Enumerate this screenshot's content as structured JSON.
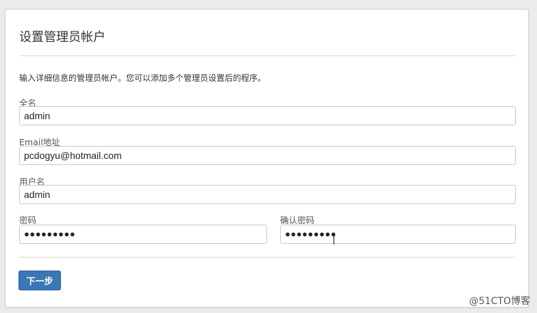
{
  "form": {
    "title": "设置管理员帐户",
    "description": "输入详细信息的管理员帐户。您可以添加多个管理员设置后的程序。",
    "fullname_label": "全名",
    "fullname_value": "admin",
    "email_label": "Email地址",
    "email_value": "pcdogyu@hotmail.com",
    "username_label": "用户名",
    "username_value": "admin",
    "password_label": "密码",
    "password_mask": "●●●●●●●●●",
    "confirm_label": "确认密码",
    "confirm_mask": "●●●●●●●●●",
    "next_button": "下一步"
  },
  "watermark": "@51CTO博客",
  "colors": {
    "primary_button": "#3b76b5",
    "page_background": "#ebebeb"
  }
}
